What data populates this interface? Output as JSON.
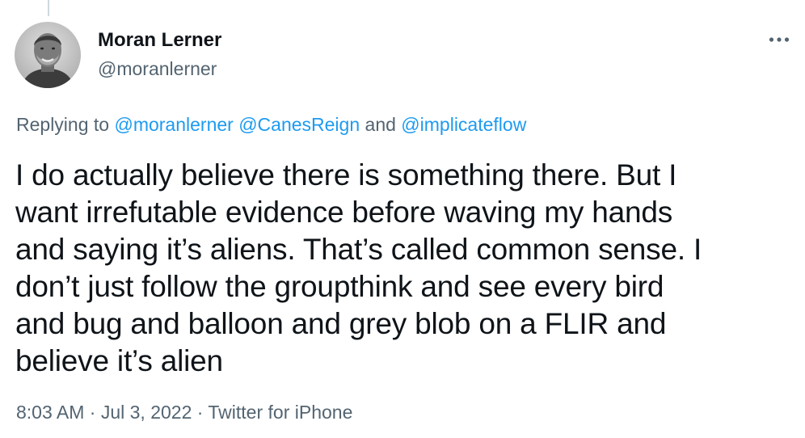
{
  "author": {
    "display_name": "Moran Lerner",
    "handle": "@moranlerner",
    "avatar_icon": "profile-photo"
  },
  "reply": {
    "prefix": "Replying to ",
    "mentions": [
      "@moranlerner",
      "@CanesReign",
      "@implicateflow"
    ],
    "joiner": " and "
  },
  "tweet": {
    "text": "I do actually believe there is something there. But I\nwant irrefutable evidence before waving my hands\nand saying it’s aliens. That’s called common sense. I\ndon’t just follow the groupthink and see every bird\nand bug and balloon and grey blob on a FLIR and\nbelieve it’s alien"
  },
  "meta": {
    "time": "8:03 AM",
    "date": "Jul 3, 2022",
    "separator": " · ",
    "source": "Twitter for iPhone"
  },
  "icons": {
    "more": "more-horizontal-icon"
  },
  "colors": {
    "text": "#0f1419",
    "secondary": "#536471",
    "link": "#1d9bf0"
  }
}
